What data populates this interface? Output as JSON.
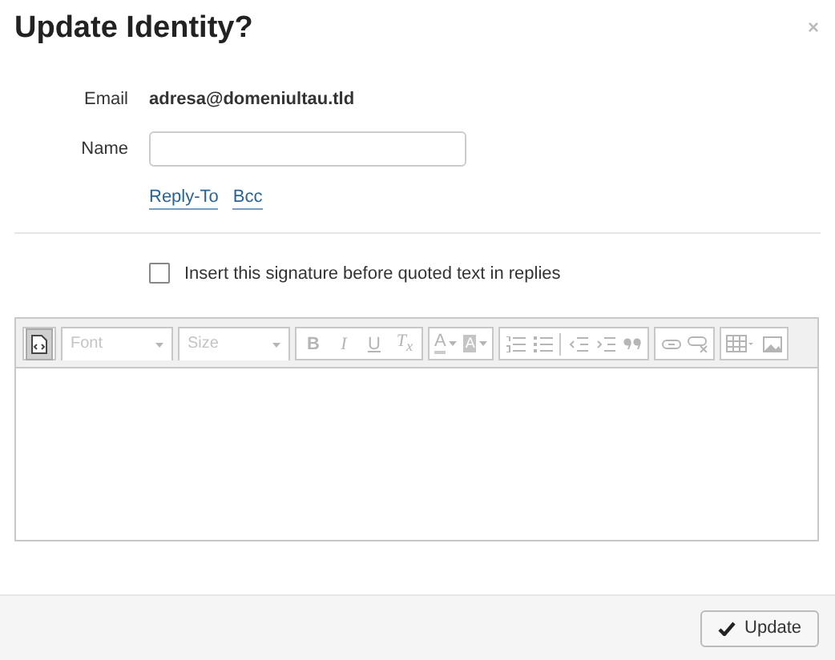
{
  "dialog": {
    "title": "Update Identity?",
    "close": "×"
  },
  "fields": [
    {
      "kind": "text",
      "label": "Email",
      "value": "adresa@domeniultau.tld"
    },
    {
      "kind": "input",
      "label": "Name"
    }
  ],
  "links": [
    "Reply-To",
    "Bcc"
  ],
  "signature_option": {
    "label": "Insert this signature before quoted text in replies",
    "checked": false
  },
  "toolbar": {
    "groups": [
      [
        {
          "kind": "source",
          "selected": true
        }
      ],
      [
        {
          "kind": "combo",
          "label": "Font",
          "selected": false
        }
      ],
      [
        {
          "kind": "combo",
          "label": "Size",
          "selected": false
        }
      ],
      [
        {
          "kind": "bold",
          "label": "B",
          "selected": false
        },
        {
          "kind": "italic",
          "label": "I",
          "selected": false
        },
        {
          "kind": "underline",
          "label": "U",
          "selected": false
        },
        {
          "kind": "removeformat",
          "label": "T$_{x}$",
          "selected": false
        }
      ],
      [
        {
          "kind": "textcolor",
          "label": "A",
          "selected": false
        },
        {
          "kind": "bgcolor",
          "label": "A",
          "selected": false
        }
      ],
      [
        {
          "kind": "olist",
          "selected": false
        },
        {
          "kind": "ulist",
          "selected": false
        },
        {
          "kind": "sep"
        },
        {
          "kind": "outdent",
          "selected": false
        },
        {
          "kind": "indent",
          "selected": false
        },
        {
          "kind": "quote",
          "selected": false
        }
      ],
      [
        {
          "kind": "link",
          "selected": false
        },
        {
          "kind": "unlink",
          "selected": false
        }
      ],
      [
        {
          "kind": "table",
          "selected": false
        },
        {
          "kind": "image",
          "selected": false
        }
      ]
    ]
  },
  "footer": {
    "button": "Update"
  }
}
